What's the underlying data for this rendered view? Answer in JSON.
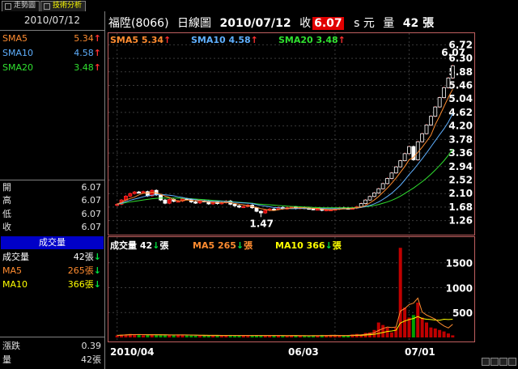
{
  "tabs": [
    {
      "label": "走勢圖",
      "active": false
    },
    {
      "label": "技術分析",
      "active": true
    }
  ],
  "left": {
    "date": "2010/07/12",
    "sma": [
      {
        "label": "SMA5",
        "value": "5.34",
        "color": "#ff8c30"
      },
      {
        "label": "SMA10",
        "value": "4.58",
        "color": "#5fb0ff"
      },
      {
        "label": "SMA20",
        "value": "3.48",
        "color": "#30e030"
      }
    ],
    "ohlc": [
      {
        "label": "開",
        "value": "6.07"
      },
      {
        "label": "高",
        "value": "6.07"
      },
      {
        "label": "低",
        "value": "6.07"
      },
      {
        "label": "收",
        "value": "6.07"
      }
    ],
    "volume_title": "成交量",
    "vol": [
      {
        "label": "成交量",
        "value": "42張",
        "color": "#ffffff"
      },
      {
        "label": "MA5",
        "value": "265張",
        "color": "#ff8c30"
      },
      {
        "label": "MA10",
        "value": "366張",
        "color": "#ffff00"
      }
    ],
    "change": {
      "label": "漲跌",
      "value": "0.39"
    },
    "qty": {
      "label": "量",
      "value": "42張"
    }
  },
  "header": {
    "stock": "福陞(8066)",
    "period": "日線圖",
    "date": "2010/07/12",
    "close_label": "收",
    "close_value": "6.07",
    "unit": "s 元",
    "vol_label": "量",
    "vol_value": "42 張"
  },
  "price_legend": [
    {
      "text": "SMA5 5.34",
      "color": "#ff8c30"
    },
    {
      "text": "SMA10 4.58",
      "color": "#5fb0ff"
    },
    {
      "text": "SMA20 3.48",
      "color": "#30e030"
    }
  ],
  "vol_legend": [
    {
      "text": "成交量 42",
      "color": "#ffffff",
      "tail": "張"
    },
    {
      "text": "MA5 265",
      "color": "#ff8c30",
      "tail": "張"
    },
    {
      "text": "MA10 366",
      "color": "#ffff00",
      "tail": "張"
    }
  ],
  "annotations": {
    "high": "6.07",
    "low": "1.47"
  },
  "x_labels": [
    "2010/04",
    "06/03",
    "07/01"
  ],
  "chart_data": {
    "type": "candlestick",
    "y_ticks": [
      "6.72",
      "6.30",
      "5.88",
      "5.46",
      "5.04",
      "4.62",
      "4.20",
      "3.78",
      "3.36",
      "2.94",
      "2.52",
      "2.10",
      "1.68",
      "1.26"
    ],
    "ylim": [
      1.05,
      6.93
    ],
    "vol_ticks": [
      1500,
      1000,
      500
    ],
    "vol_ylim": [
      0,
      1950
    ],
    "closes": [
      1.77,
      1.9,
      2.02,
      2.1,
      2.15,
      2.14,
      2.16,
      2.03,
      2.2,
      2.06,
      1.9,
      1.8,
      1.92,
      1.86,
      1.87,
      1.94,
      1.92,
      1.84,
      1.81,
      1.88,
      1.86,
      1.78,
      1.84,
      1.79,
      1.82,
      1.87,
      1.77,
      1.72,
      1.68,
      1.7,
      1.74,
      1.66,
      1.55,
      1.5,
      1.58,
      1.62,
      1.61,
      1.67,
      1.63,
      1.66,
      1.68,
      1.64,
      1.67,
      1.65,
      1.63,
      1.61,
      1.62,
      1.58,
      1.6,
      1.6,
      1.62,
      1.66,
      1.65,
      1.64,
      1.65,
      1.69,
      1.79,
      1.9,
      2.01,
      2.12,
      2.25,
      2.41,
      2.57,
      2.74,
      2.93,
      3.12,
      3.34,
      3.56,
      3.15,
      3.71,
      3.96,
      4.23,
      4.5,
      4.79,
      5.08,
      5.39,
      5.69,
      6.07
    ],
    "volumes": [
      40,
      55,
      60,
      70,
      60,
      50,
      45,
      50,
      60,
      55,
      45,
      50,
      40,
      45,
      60,
      50,
      45,
      40,
      35,
      30,
      35,
      45,
      40,
      35,
      30,
      35,
      50,
      40,
      35,
      45,
      30,
      40,
      45,
      35,
      30,
      40,
      45,
      35,
      30,
      25,
      40,
      45,
      35,
      30,
      25,
      35,
      40,
      50,
      45,
      40,
      35,
      30,
      40,
      45,
      60,
      70,
      60,
      90,
      100,
      150,
      300,
      250,
      200,
      100,
      200,
      1800,
      600,
      400,
      450,
      700,
      400,
      300,
      200,
      180,
      150,
      120,
      80,
      42
    ],
    "sma5": [
      1.77,
      1.83,
      1.9,
      1.95,
      1.99,
      2.06,
      2.11,
      2.12,
      2.14,
      2.12,
      2.08,
      2.02,
      1.98,
      1.91,
      1.87,
      1.88,
      1.9,
      1.89,
      1.88,
      1.88,
      1.86,
      1.84,
      1.83,
      1.83,
      1.82,
      1.82,
      1.82,
      1.79,
      1.77,
      1.75,
      1.72,
      1.7,
      1.67,
      1.63,
      1.61,
      1.58,
      1.57,
      1.6,
      1.62,
      1.64,
      1.65,
      1.66,
      1.66,
      1.66,
      1.65,
      1.64,
      1.64,
      1.62,
      1.61,
      1.6,
      1.61,
      1.61,
      1.63,
      1.63,
      1.64,
      1.66,
      1.68,
      1.73,
      1.81,
      1.9,
      2.01,
      2.14,
      2.27,
      2.42,
      2.58,
      2.76,
      2.94,
      3.15,
      3.22,
      3.38,
      3.54,
      3.72,
      3.91,
      4.24,
      4.51,
      4.8,
      5.09,
      5.34
    ],
    "sma10": [
      1.77,
      1.8,
      1.85,
      1.89,
      1.93,
      1.96,
      2.0,
      2.03,
      2.05,
      2.06,
      2.07,
      2.06,
      2.05,
      2.03,
      2.0,
      1.98,
      1.95,
      1.93,
      1.91,
      1.89,
      1.88,
      1.87,
      1.86,
      1.86,
      1.86,
      1.85,
      1.84,
      1.83,
      1.82,
      1.81,
      1.8,
      1.79,
      1.76,
      1.73,
      1.71,
      1.69,
      1.67,
      1.66,
      1.65,
      1.64,
      1.63,
      1.63,
      1.64,
      1.64,
      1.64,
      1.64,
      1.64,
      1.64,
      1.63,
      1.63,
      1.63,
      1.63,
      1.63,
      1.63,
      1.64,
      1.65,
      1.67,
      1.7,
      1.73,
      1.78,
      1.84,
      1.92,
      2.01,
      2.11,
      2.23,
      2.36,
      2.52,
      2.69,
      2.84,
      3.01,
      3.18,
      3.36,
      3.55,
      3.74,
      3.93,
      4.11,
      4.32,
      4.58
    ],
    "sma20": [
      1.77,
      1.79,
      1.82,
      1.84,
      1.86,
      1.88,
      1.9,
      1.92,
      1.94,
      1.95,
      1.96,
      1.96,
      1.96,
      1.96,
      1.96,
      1.95,
      1.95,
      1.94,
      1.93,
      1.92,
      1.91,
      1.9,
      1.89,
      1.88,
      1.87,
      1.86,
      1.85,
      1.84,
      1.83,
      1.82,
      1.81,
      1.8,
      1.78,
      1.77,
      1.76,
      1.75,
      1.74,
      1.73,
      1.72,
      1.71,
      1.7,
      1.7,
      1.69,
      1.68,
      1.68,
      1.67,
      1.67,
      1.66,
      1.66,
      1.66,
      1.66,
      1.66,
      1.66,
      1.66,
      1.66,
      1.67,
      1.68,
      1.69,
      1.71,
      1.73,
      1.76,
      1.8,
      1.84,
      1.89,
      1.95,
      2.02,
      2.1,
      2.19,
      2.27,
      2.37,
      2.47,
      2.58,
      2.7,
      2.83,
      2.97,
      3.12,
      3.29,
      3.48
    ],
    "vol_ma5": [
      40,
      45,
      50,
      55,
      57,
      59,
      57,
      53,
      53,
      52,
      51,
      52,
      50,
      49,
      48,
      50,
      48,
      46,
      44,
      40,
      37,
      37,
      37,
      37,
      37,
      37,
      38,
      38,
      38,
      41,
      40,
      38,
      39,
      39,
      37,
      38,
      39,
      39,
      37,
      35,
      35,
      37,
      35,
      34,
      35,
      34,
      33,
      36,
      39,
      42,
      43,
      40,
      38,
      40,
      44,
      49,
      53,
      63,
      76,
      94,
      140,
      178,
      210,
      200,
      210,
      530,
      580,
      660,
      690,
      790,
      510,
      450,
      410,
      366,
      290,
      230,
      190,
      265
    ],
    "vol_ma10": [
      40,
      45,
      50,
      55,
      57,
      57,
      56,
      55,
      55,
      55,
      54,
      53,
      51,
      50,
      50,
      51,
      50,
      49,
      47,
      45,
      44,
      43,
      43,
      42,
      41,
      41,
      41,
      40,
      39,
      39,
      39,
      38,
      38,
      39,
      38,
      39,
      39,
      38,
      38,
      37,
      38,
      38,
      37,
      36,
      35,
      36,
      36,
      37,
      37,
      37,
      37,
      37,
      37,
      37,
      38,
      40,
      43,
      48,
      54,
      62,
      82,
      100,
      120,
      130,
      145,
      290,
      330,
      360,
      380,
      420,
      380,
      366,
      360,
      350,
      345,
      366,
      360,
      366
    ]
  }
}
